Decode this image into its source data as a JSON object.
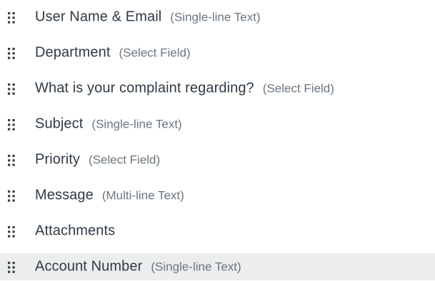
{
  "fields": [
    {
      "label": "User Name & Email",
      "type": "(Single-line Text)",
      "icon": "drag-handle-icon"
    },
    {
      "label": "Department",
      "type": "(Select Field)",
      "icon": "drag-handle-icon"
    },
    {
      "label": "What is your complaint regarding?",
      "type": "(Select Field)",
      "icon": "drag-handle-icon"
    },
    {
      "label": "Subject",
      "type": "(Single-line Text)",
      "icon": "drag-handle-icon"
    },
    {
      "label": "Priority",
      "type": "(Select Field)",
      "icon": "drag-handle-icon"
    },
    {
      "label": "Message",
      "type": "(Multi-line Text)",
      "icon": "drag-handle-icon"
    },
    {
      "label": "Attachments",
      "type": "",
      "icon": "drag-handle-icon"
    },
    {
      "label": "Account Number",
      "type": "(Single-line Text)",
      "icon": "drag-handle-icon",
      "highlighted": true
    }
  ],
  "colors": {
    "label": "#2f3a45",
    "type": "#6a7580",
    "handle": "#3a3f45",
    "highlight_bg": "#eceeee"
  }
}
